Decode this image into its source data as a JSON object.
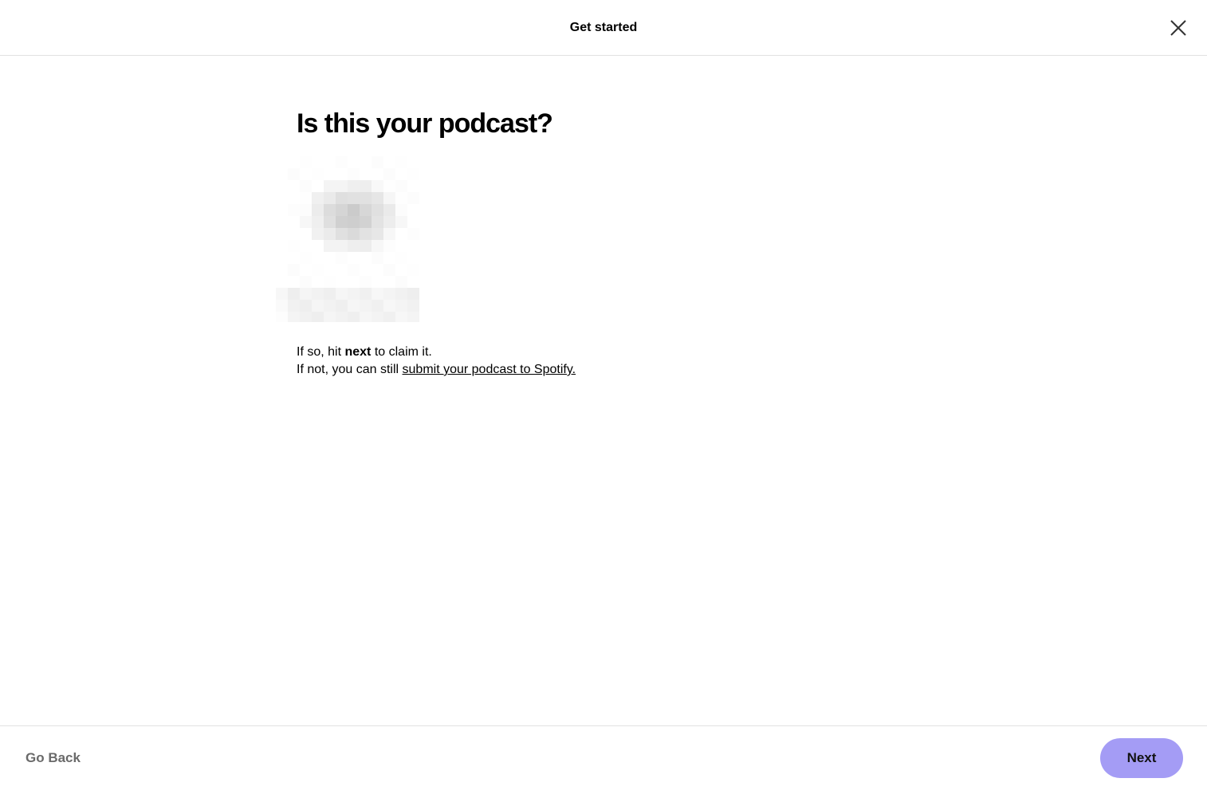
{
  "header": {
    "title": "Get started",
    "close_icon": "close-icon"
  },
  "main": {
    "headline": "Is this your podcast?",
    "description": {
      "line1_prefix": "If so, hit ",
      "line1_bold": "next",
      "line1_suffix": " to claim it.",
      "line2_prefix": "If not, you can still ",
      "line2_link": "submit your podcast to Spotify."
    }
  },
  "footer": {
    "back_label": "Go Back",
    "next_label": "Next"
  },
  "colors": {
    "next_button_bg": "#a49cf5",
    "border": "#e2e2e2",
    "muted_text": "#6a6a6a"
  }
}
